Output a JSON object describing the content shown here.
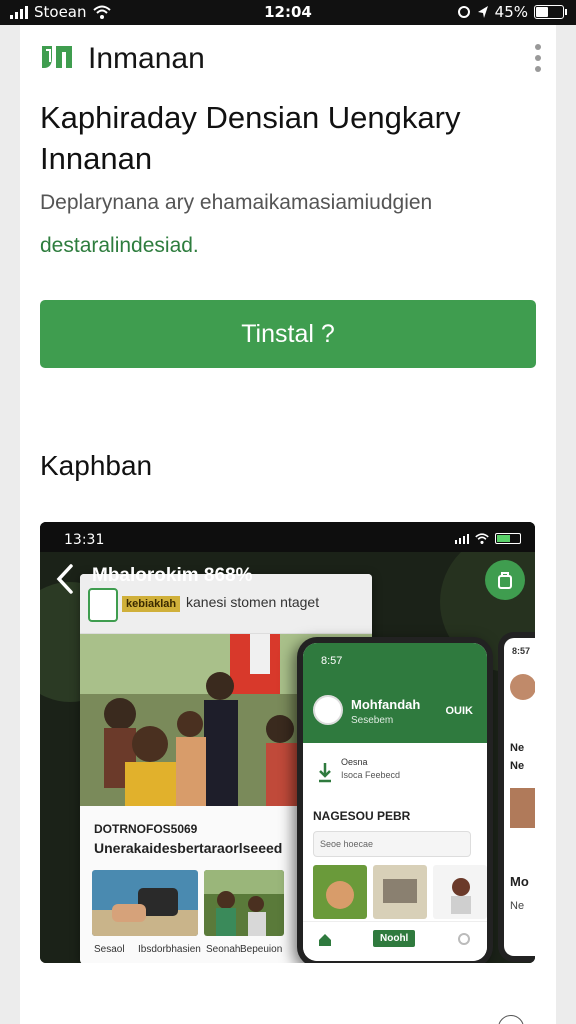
{
  "status_bar": {
    "carrier": "Stoean",
    "time": "12:04",
    "battery": "45%",
    "battery_level": 0.45
  },
  "header": {
    "app_name": "Inmanan"
  },
  "hero": {
    "headline": "Kaphiraday Densian Uengkary Innanan",
    "description": "Deplarynana ary ehamaikamasiamiudgien",
    "link_text": "destaralindesiad."
  },
  "install_button": {
    "label": "Tinstal ?"
  },
  "screenshots_section": {
    "title": "Kaphban",
    "screenshot": {
      "time": "13:31",
      "title": "Mbalorokim 868%",
      "site_badge": "kebiaklah",
      "site_tag": "kanesi stomen ntaget",
      "news_category": "DOTRNOFOS5069",
      "news_headline": "Unerakaidesbertaraorlseeed",
      "captions": [
        "Sesaol",
        "Ibsdorbhasien",
        "Seonah",
        "Bepeuion"
      ],
      "phone": {
        "time": "8:57",
        "user_name": "Mohfandah",
        "user_sub": "Sesebem",
        "right_label": "OUIK",
        "row_title": "Oesna",
        "row_sub": "Isoca Feebecd",
        "section_label": "NAGESOU PEBR",
        "search_placeholder": "Seoe hoecae",
        "nav_button": "Noohl"
      },
      "phone2": {
        "time": "8:57",
        "items": [
          "Ne",
          "Ne",
          "Mo",
          "Ne"
        ]
      }
    }
  },
  "colors": {
    "accent": "#3f9d4f",
    "link": "#2e7d3e",
    "dark_green": "#2f7a3e"
  },
  "icons": [
    "wifi-icon",
    "signal-icon",
    "battery-icon",
    "app-logo-icon",
    "more-vert-icon",
    "back-arrow-icon",
    "share-icon",
    "info-icon"
  ]
}
